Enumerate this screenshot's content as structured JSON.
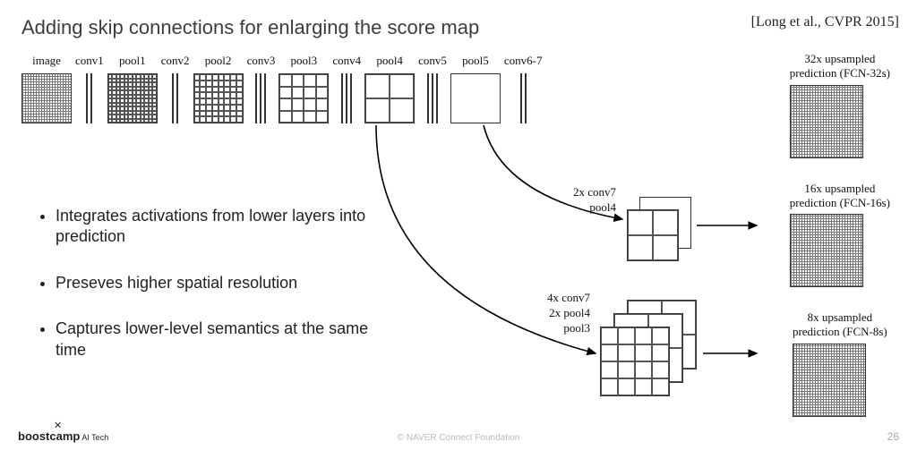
{
  "title": "Adding skip connections for enlarging the score map",
  "citation": "[Long et al., CVPR 2015]",
  "stages": [
    "image",
    "conv1",
    "pool1",
    "conv2",
    "pool2",
    "conv3",
    "pool3",
    "conv4",
    "pool4",
    "conv5",
    "pool5",
    "conv6-7"
  ],
  "predictions": [
    {
      "line1": "32x upsampled",
      "line2": "prediction (FCN-32s)"
    },
    {
      "line1": "16x upsampled",
      "line2": "prediction (FCN-16s)"
    },
    {
      "line1": "8x upsampled",
      "line2": "prediction (FCN-8s)"
    }
  ],
  "bullets": [
    "Integrates activations from lower layers into prediction",
    "Preseves higher spatial resolution",
    "Captures lower-level semantics at the same time"
  ],
  "stack16": {
    "back": "2x conv7",
    "front": "pool4"
  },
  "stack8": {
    "back": "4x conv7",
    "mid": "2x pool4",
    "front": "pool3"
  },
  "footer": {
    "logo_main": "boostcamp",
    "logo_sub": "AI Tech",
    "copyright": "© NAVER Connect Foundation",
    "page": "26"
  }
}
